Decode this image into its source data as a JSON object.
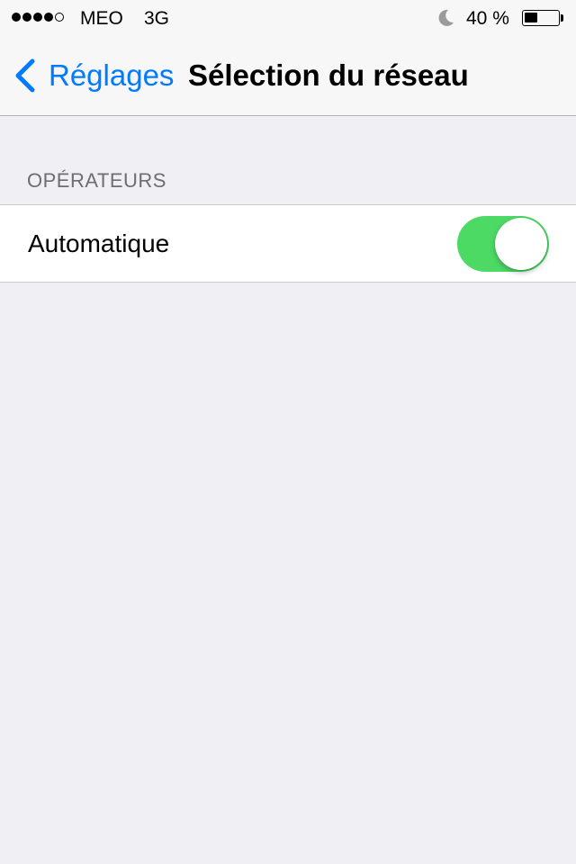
{
  "status_bar": {
    "signal_bars_filled": 4,
    "signal_bars_total": 5,
    "carrier": "MEO",
    "network": "3G",
    "do_not_disturb_icon": "moon-icon",
    "battery_text": "40 %",
    "battery_level": 0.4
  },
  "nav_bar": {
    "back_label": "Réglages",
    "back_icon": "chevron-left-icon",
    "title": "Sélection du réseau"
  },
  "section": {
    "header": "OPÉRATEURS",
    "cell": {
      "label": "Automatique",
      "switch_on": true
    }
  },
  "colors": {
    "accent": "#007aff",
    "switch_on": "#4cd964",
    "background": "#efeff4",
    "section_header": "#6d6d72"
  }
}
